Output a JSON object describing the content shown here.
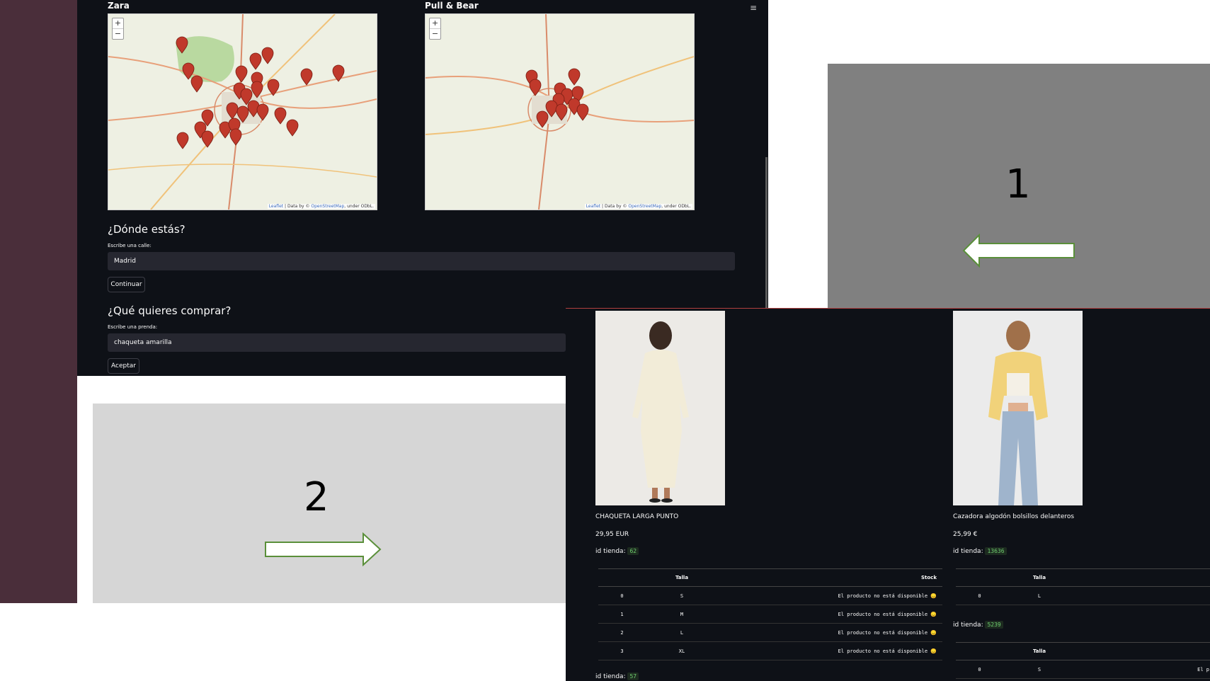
{
  "maps": [
    {
      "title": "Zara",
      "zoom_in": "+",
      "zoom_out": "−",
      "attrib_leaflet": "Leaflet",
      "attrib_text": " | Data by © ",
      "attrib_osm": "OpenStreetMap",
      "attrib_tail": ", under ODbL."
    },
    {
      "title": "Pull & Bear",
      "zoom_in": "+",
      "zoom_out": "−",
      "attrib_leaflet": "Leaflet",
      "attrib_text": " | Data by © ",
      "attrib_osm": "OpenStreetMap",
      "attrib_tail": ", under ODbL."
    }
  ],
  "menu_icon": "≡",
  "where": {
    "heading": "¿Dónde estás?",
    "label": "Escribe una calle:",
    "value": "Madrid",
    "button": "Continuar"
  },
  "what": {
    "heading": "¿Qué quieres comprar?",
    "label": "Escribe una prenda:",
    "value": "chaqueta amarilla",
    "button": "Aceptar"
  },
  "annotations": {
    "one": "1",
    "two": "2"
  },
  "products": [
    {
      "name": "CHAQUETA LARGA PUNTO",
      "price": "29,95 EUR",
      "store_label": "id tienda:",
      "store_id": "62",
      "table_headers": [
        "",
        "Talla",
        "Stock"
      ],
      "rows": [
        [
          "0",
          "S",
          "El producto no está disponible 😞"
        ],
        [
          "1",
          "M",
          "El producto no está disponible 😞"
        ],
        [
          "2",
          "L",
          "El producto no está disponible 😞"
        ],
        [
          "3",
          "XL",
          "El producto no está disponible 😞"
        ]
      ],
      "next_store_label": "id tienda:",
      "next_store_id": "57"
    },
    {
      "name": "Cazadora algodón bolsillos delanteros",
      "price": "25,99 €",
      "store_label": "id tienda:",
      "store_id": "13636",
      "table_headers": [
        "",
        "Talla"
      ],
      "rows": [
        [
          "0",
          "L"
        ]
      ],
      "store2_label": "id tienda:",
      "store2_id": "5239",
      "table2_headers": [
        "",
        "Talla"
      ],
      "rows2": [
        [
          "0",
          "S",
          "El p"
        ]
      ]
    }
  ],
  "colors": {
    "app_bg": "#0e1117",
    "input_bg": "#262730",
    "sidebar": "#4a2e3a",
    "marker": "#c0392b",
    "badge_green": "#6fcf6f",
    "arrow_outline": "#5a8f3a"
  }
}
